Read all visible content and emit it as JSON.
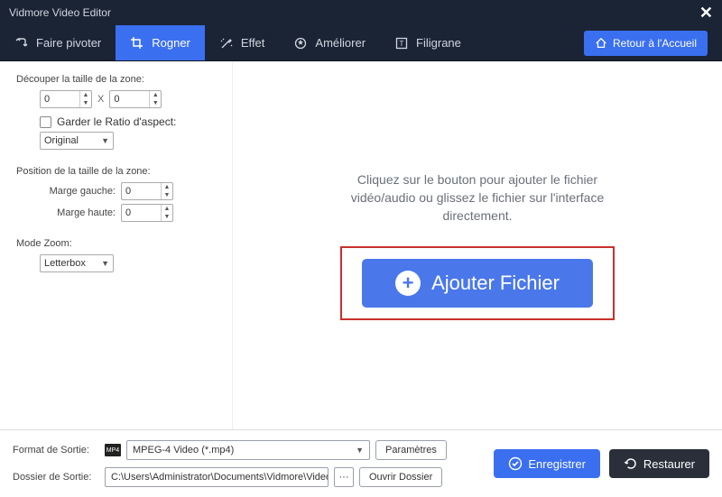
{
  "titlebar": {
    "title": "Vidmore Video Editor"
  },
  "tabs": {
    "rotate": "Faire pivoter",
    "crop": "Rogner",
    "effect": "Effet",
    "enhance": "Améliorer",
    "watermark": "Filigrane"
  },
  "home_btn": "Retour à l'Accueil",
  "sidebar": {
    "crop_size_title": "Découper la taille de la zone:",
    "width": "0",
    "height": "0",
    "x": "X",
    "keep_ratio": "Garder le Ratio d'aspect:",
    "ratio_value": "Original",
    "pos_title": "Position de la taille de la zone:",
    "margin_left_lbl": "Marge gauche:",
    "margin_left": "0",
    "margin_top_lbl": "Marge haute:",
    "margin_top": "0",
    "zoom_title": "Mode Zoom:",
    "zoom_value": "Letterbox"
  },
  "canvas": {
    "hint_l1": "Cliquez sur le bouton pour ajouter le fichier",
    "hint_l2": "vidéo/audio ou glissez le fichier sur l'interface",
    "hint_l3": "directement.",
    "add_label": "Ajouter Fichier"
  },
  "bottom": {
    "format_lbl": "Format de Sortie:",
    "format_value": "MPEG-4 Video (*.mp4)",
    "format_icon": "MP4",
    "settings_btn": "Paramètres",
    "folder_lbl": "Dossier de Sortie:",
    "folder_value": "C:\\Users\\Administrator\\Documents\\Vidmore\\Video",
    "open_folder_btn": "Ouvrir Dossier",
    "save_btn": "Enregistrer",
    "restore_btn": "Restaurer"
  }
}
